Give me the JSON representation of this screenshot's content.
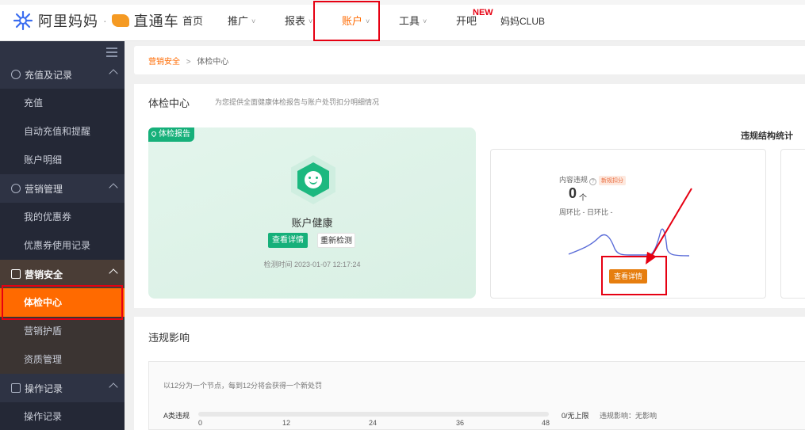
{
  "brand": {
    "name": "阿里妈妈",
    "separator": "·",
    "product": "直通车"
  },
  "nav": {
    "items": [
      {
        "label": "首页",
        "chevron": false
      },
      {
        "label": "推广",
        "chevron": true
      },
      {
        "label": "报表",
        "chevron": true
      },
      {
        "label": "账户",
        "chevron": true,
        "active": true
      },
      {
        "label": "工具",
        "chevron": true
      },
      {
        "label": "开吧",
        "chevron": false
      },
      {
        "label": "妈妈CLUB",
        "chevron": false
      }
    ],
    "new_badge": "NEW",
    "chevron_glyph": "˅"
  },
  "sidebar": {
    "groups": [
      {
        "label": "充值及记录",
        "icon": "yen-circle-icon",
        "items": [
          "充值",
          "自动充值和提醒",
          "账户明细"
        ]
      },
      {
        "label": "营销管理",
        "icon": "marketing-icon",
        "items": [
          "我的优惠券",
          "优惠券使用记录"
        ]
      },
      {
        "label": "营销安全",
        "icon": "shield-icon",
        "items": [
          "体检中心",
          "营销护盾",
          "资质管理"
        ]
      },
      {
        "label": "操作记录",
        "icon": "record-icon",
        "items": [
          "操作记录"
        ]
      }
    ],
    "selected_item": "体检中心"
  },
  "breadcrumb": {
    "parent": "营销安全",
    "separator": ">",
    "current": "体检中心"
  },
  "health_panel": {
    "title": "体检中心",
    "description": "为您提供全面健康体检报告与账户处罚扣分明细情况",
    "report_tag": "体检报告",
    "status": "账户健康",
    "view_details": "查看详情",
    "recheck": "重新检测",
    "check_time": "检测时间 2023-01-07 12:17:24"
  },
  "violation_stats": {
    "title": "违规结构统计",
    "card": {
      "label": "内容违规",
      "help": "?",
      "tag": "新规扣分",
      "count": "0",
      "unit": "个",
      "ratio": "周环比 -   日环比 -",
      "button": "查看详情"
    }
  },
  "impact_panel": {
    "title": "违规影响",
    "description": "以12分为一个节点，每到12分将会获得一个新处罚",
    "row_label": "A类违规",
    "ticks": [
      "0",
      "12",
      "24",
      "36",
      "48"
    ],
    "current_score": 0,
    "max_score": 48,
    "limit_text": "0/无上限",
    "effect_text": "违规影响：无影响"
  },
  "colors": {
    "accent": "#ff6a00",
    "green": "#16b07a",
    "annotation": "#e60012",
    "sidebar": "#2e3344"
  }
}
